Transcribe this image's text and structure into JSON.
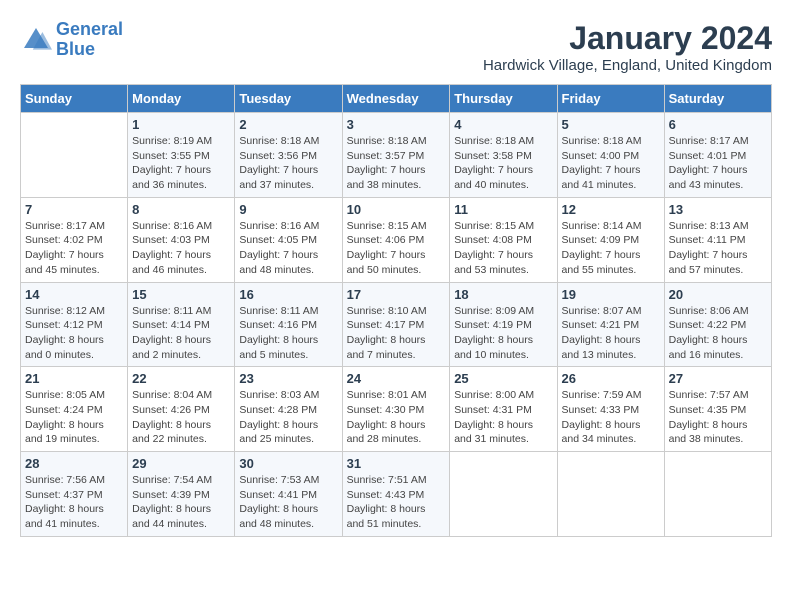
{
  "header": {
    "logo_line1": "General",
    "logo_line2": "Blue",
    "title": "January 2024",
    "location": "Hardwick Village, England, United Kingdom"
  },
  "calendar": {
    "days_of_week": [
      "Sunday",
      "Monday",
      "Tuesday",
      "Wednesday",
      "Thursday",
      "Friday",
      "Saturday"
    ],
    "weeks": [
      [
        {
          "day": "",
          "info": ""
        },
        {
          "day": "1",
          "info": "Sunrise: 8:19 AM\nSunset: 3:55 PM\nDaylight: 7 hours\nand 36 minutes."
        },
        {
          "day": "2",
          "info": "Sunrise: 8:18 AM\nSunset: 3:56 PM\nDaylight: 7 hours\nand 37 minutes."
        },
        {
          "day": "3",
          "info": "Sunrise: 8:18 AM\nSunset: 3:57 PM\nDaylight: 7 hours\nand 38 minutes."
        },
        {
          "day": "4",
          "info": "Sunrise: 8:18 AM\nSunset: 3:58 PM\nDaylight: 7 hours\nand 40 minutes."
        },
        {
          "day": "5",
          "info": "Sunrise: 8:18 AM\nSunset: 4:00 PM\nDaylight: 7 hours\nand 41 minutes."
        },
        {
          "day": "6",
          "info": "Sunrise: 8:17 AM\nSunset: 4:01 PM\nDaylight: 7 hours\nand 43 minutes."
        }
      ],
      [
        {
          "day": "7",
          "info": "Sunrise: 8:17 AM\nSunset: 4:02 PM\nDaylight: 7 hours\nand 45 minutes."
        },
        {
          "day": "8",
          "info": "Sunrise: 8:16 AM\nSunset: 4:03 PM\nDaylight: 7 hours\nand 46 minutes."
        },
        {
          "day": "9",
          "info": "Sunrise: 8:16 AM\nSunset: 4:05 PM\nDaylight: 7 hours\nand 48 minutes."
        },
        {
          "day": "10",
          "info": "Sunrise: 8:15 AM\nSunset: 4:06 PM\nDaylight: 7 hours\nand 50 minutes."
        },
        {
          "day": "11",
          "info": "Sunrise: 8:15 AM\nSunset: 4:08 PM\nDaylight: 7 hours\nand 53 minutes."
        },
        {
          "day": "12",
          "info": "Sunrise: 8:14 AM\nSunset: 4:09 PM\nDaylight: 7 hours\nand 55 minutes."
        },
        {
          "day": "13",
          "info": "Sunrise: 8:13 AM\nSunset: 4:11 PM\nDaylight: 7 hours\nand 57 minutes."
        }
      ],
      [
        {
          "day": "14",
          "info": "Sunrise: 8:12 AM\nSunset: 4:12 PM\nDaylight: 8 hours\nand 0 minutes."
        },
        {
          "day": "15",
          "info": "Sunrise: 8:11 AM\nSunset: 4:14 PM\nDaylight: 8 hours\nand 2 minutes."
        },
        {
          "day": "16",
          "info": "Sunrise: 8:11 AM\nSunset: 4:16 PM\nDaylight: 8 hours\nand 5 minutes."
        },
        {
          "day": "17",
          "info": "Sunrise: 8:10 AM\nSunset: 4:17 PM\nDaylight: 8 hours\nand 7 minutes."
        },
        {
          "day": "18",
          "info": "Sunrise: 8:09 AM\nSunset: 4:19 PM\nDaylight: 8 hours\nand 10 minutes."
        },
        {
          "day": "19",
          "info": "Sunrise: 8:07 AM\nSunset: 4:21 PM\nDaylight: 8 hours\nand 13 minutes."
        },
        {
          "day": "20",
          "info": "Sunrise: 8:06 AM\nSunset: 4:22 PM\nDaylight: 8 hours\nand 16 minutes."
        }
      ],
      [
        {
          "day": "21",
          "info": "Sunrise: 8:05 AM\nSunset: 4:24 PM\nDaylight: 8 hours\nand 19 minutes."
        },
        {
          "day": "22",
          "info": "Sunrise: 8:04 AM\nSunset: 4:26 PM\nDaylight: 8 hours\nand 22 minutes."
        },
        {
          "day": "23",
          "info": "Sunrise: 8:03 AM\nSunset: 4:28 PM\nDaylight: 8 hours\nand 25 minutes."
        },
        {
          "day": "24",
          "info": "Sunrise: 8:01 AM\nSunset: 4:30 PM\nDaylight: 8 hours\nand 28 minutes."
        },
        {
          "day": "25",
          "info": "Sunrise: 8:00 AM\nSunset: 4:31 PM\nDaylight: 8 hours\nand 31 minutes."
        },
        {
          "day": "26",
          "info": "Sunrise: 7:59 AM\nSunset: 4:33 PM\nDaylight: 8 hours\nand 34 minutes."
        },
        {
          "day": "27",
          "info": "Sunrise: 7:57 AM\nSunset: 4:35 PM\nDaylight: 8 hours\nand 38 minutes."
        }
      ],
      [
        {
          "day": "28",
          "info": "Sunrise: 7:56 AM\nSunset: 4:37 PM\nDaylight: 8 hours\nand 41 minutes."
        },
        {
          "day": "29",
          "info": "Sunrise: 7:54 AM\nSunset: 4:39 PM\nDaylight: 8 hours\nand 44 minutes."
        },
        {
          "day": "30",
          "info": "Sunrise: 7:53 AM\nSunset: 4:41 PM\nDaylight: 8 hours\nand 48 minutes."
        },
        {
          "day": "31",
          "info": "Sunrise: 7:51 AM\nSunset: 4:43 PM\nDaylight: 8 hours\nand 51 minutes."
        },
        {
          "day": "",
          "info": ""
        },
        {
          "day": "",
          "info": ""
        },
        {
          "day": "",
          "info": ""
        }
      ]
    ]
  }
}
